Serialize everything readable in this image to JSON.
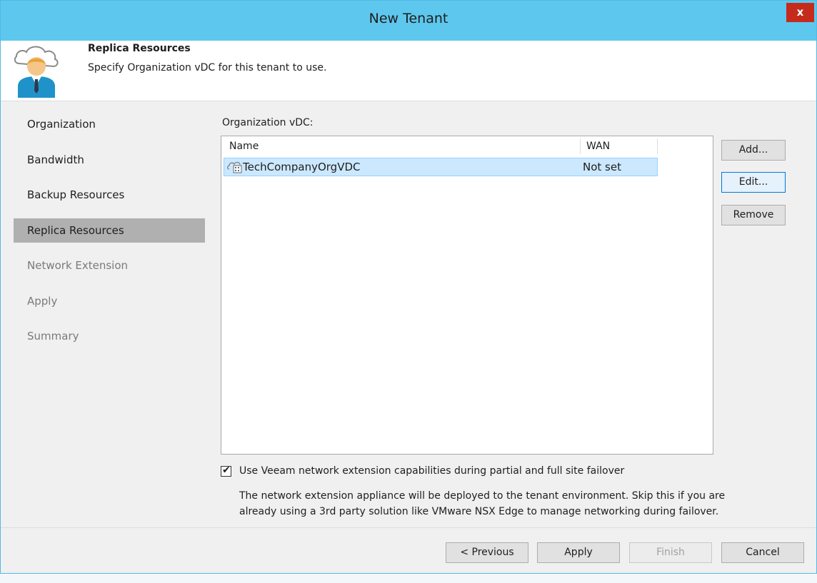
{
  "window": {
    "title": "New Tenant",
    "close_label": "x"
  },
  "header": {
    "title": "Replica Resources",
    "description": "Specify Organization vDC for this tenant to use.",
    "icon": "tenant-user-cloud-icon"
  },
  "sidebar": {
    "items": [
      {
        "label": "Organization",
        "state": "enabled"
      },
      {
        "label": "Bandwidth",
        "state": "enabled"
      },
      {
        "label": "Backup Resources",
        "state": "enabled"
      },
      {
        "label": "Replica Resources",
        "state": "active"
      },
      {
        "label": "Network Extension",
        "state": "disabled"
      },
      {
        "label": "Apply",
        "state": "disabled"
      },
      {
        "label": "Summary",
        "state": "disabled"
      }
    ]
  },
  "main": {
    "list_label": "Organization vDC:",
    "columns": [
      "Name",
      "WAN"
    ],
    "rows": [
      {
        "name": "TechCompanyOrgVDC",
        "wan": "Not set",
        "icon": "org-vdc-icon",
        "selected": true
      }
    ],
    "side_buttons": {
      "add": "Add...",
      "edit": "Edit...",
      "remove": "Remove"
    },
    "checkbox": {
      "checked": true,
      "label": "Use Veeam network extension capabilities during partial and full site failover"
    },
    "note_line1": "The network extension appliance will be deployed to the tenant environment. Skip this if you are",
    "note_line2": "already using a 3rd party solution like VMware NSX Edge to manage networking during failover."
  },
  "footer": {
    "previous": "< Previous",
    "apply": "Apply",
    "finish": "Finish",
    "cancel": "Cancel"
  },
  "colors": {
    "titlebar": "#5ec7ee",
    "close": "#c42b1c",
    "selection": "#cce8ff",
    "nav_active": "#b0b0b0"
  }
}
